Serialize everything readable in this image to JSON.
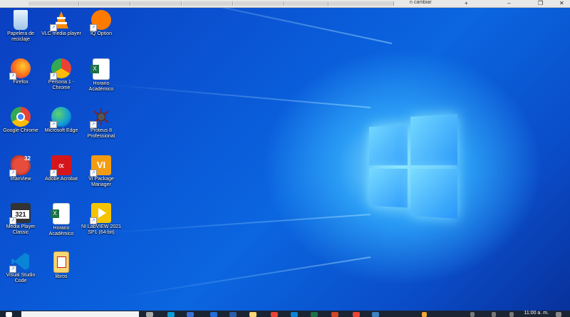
{
  "desktop": {
    "icons": [
      {
        "label": "Papelera de\nreciclaje",
        "icon": "recycle-bin-icon",
        "color": "#e6f2ff"
      },
      {
        "label": "VLC media player",
        "icon": "vlc-cone-icon",
        "color": "#ff8a00"
      },
      {
        "label": "IQ Option",
        "icon": "iq-option-icon",
        "color": "#ff7a00"
      },
      {
        "label": "Firefox",
        "icon": "firefox-icon",
        "color": "#ff6a1a"
      },
      {
        "label": "Persona 1 -\nChrome",
        "icon": "chrome-profile-icon",
        "color": "#4285f4"
      },
      {
        "label": "Horario\nAcadémico",
        "icon": "excel-icon",
        "color": "#1e7145"
      },
      {
        "label": "Google Chrome",
        "icon": "chrome-icon",
        "color": "#34a853"
      },
      {
        "label": "Microsoft Edge",
        "icon": "edge-icon",
        "color": "#0f9bd7"
      },
      {
        "label": "Proteus 8\nProfessional",
        "icon": "proteus-icon",
        "color": "#8a1c1c"
      },
      {
        "label": "IrfanView",
        "icon": "irfanview-icon",
        "color": "#c0392b"
      },
      {
        "label": "Adobe Acrobat",
        "icon": "acrobat-icon",
        "color": "#d4161c"
      },
      {
        "label": "VI Package\nManager",
        "icon": "vipm-icon",
        "color": "#f39c12"
      },
      {
        "label": "Media Player\nClassic",
        "icon": "media-player-classic-icon",
        "color": "#333333"
      },
      {
        "label": "Horario\nAcadémico",
        "icon": "excel-icon",
        "color": "#1e7145"
      },
      {
        "label": "NI LabVIEW 2021\nSP1 (64-bit)",
        "icon": "labview-icon",
        "color": "#f5c400"
      },
      {
        "label": "Visual Studio\nCode",
        "icon": "vscode-icon",
        "color": "#0a84d6"
      },
      {
        "label": "libros",
        "icon": "folder-icon",
        "color": "#f7d774"
      }
    ]
  },
  "browser_strip": {
    "tab_text": "n cambiar",
    "controls": [
      "+",
      "–",
      "❐",
      "✕"
    ]
  },
  "taskbar": {
    "clock": "11:00 a. m."
  }
}
